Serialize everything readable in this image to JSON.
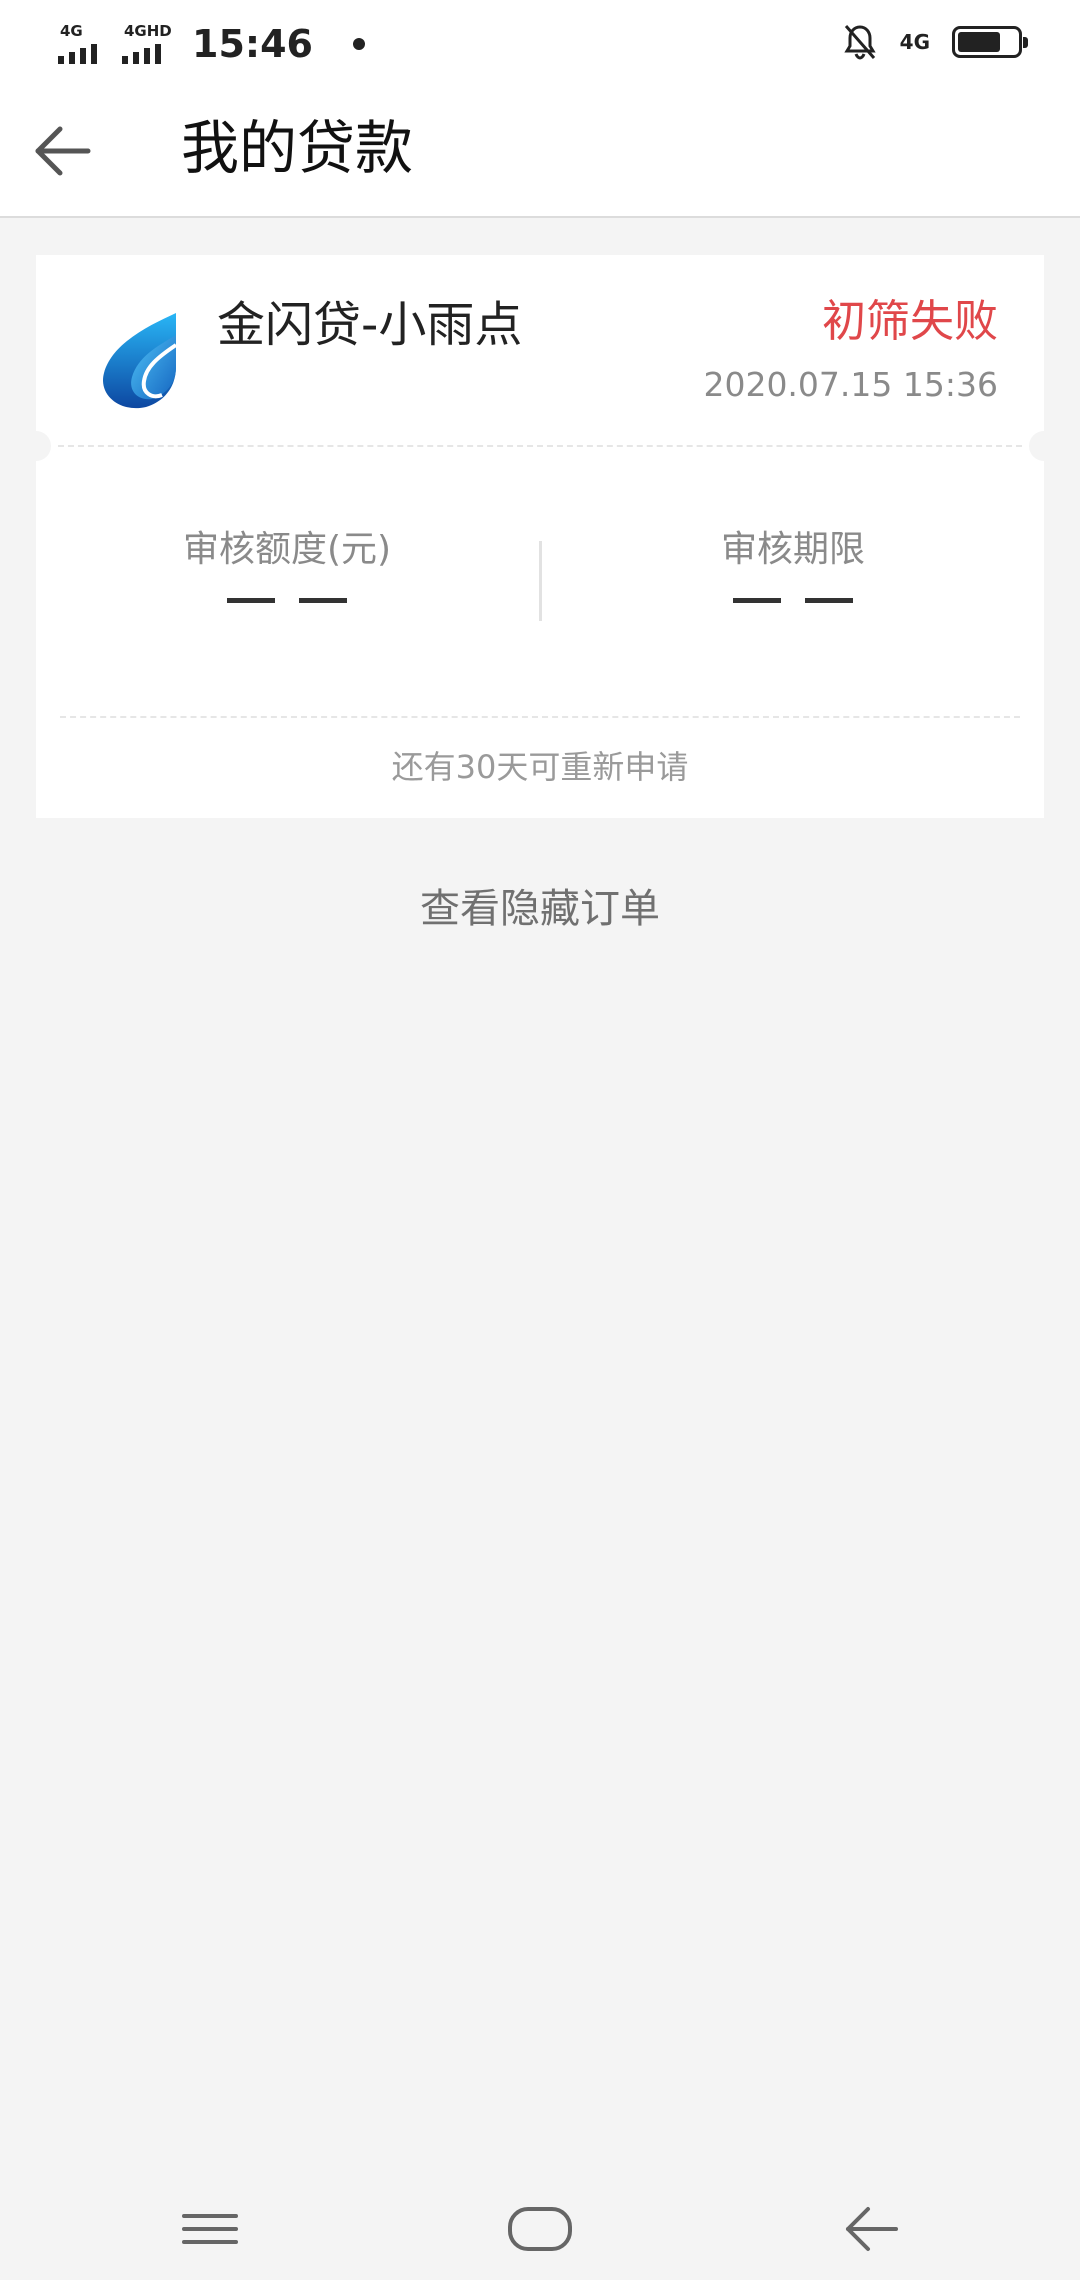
{
  "status_bar": {
    "sim1": "4G",
    "sim2": "4GHD",
    "time": "15:46",
    "data_type": "4G",
    "battery_level": 0.72,
    "icons": [
      "signal-icon",
      "notification-muted-icon",
      "battery-icon"
    ]
  },
  "header": {
    "title": "我的贷款",
    "back_icon": "back-arrow-icon"
  },
  "loan_card": {
    "product_name": "金闪贷-小雨点",
    "status": "初筛失败",
    "status_color": "#e0474a",
    "datetime": "2020.07.15 15:36",
    "logo_icon": "product-logo-icon",
    "amount": {
      "label": "审核额度(元)",
      "value": "— —"
    },
    "term": {
      "label": "审核期限",
      "value": "— —"
    },
    "reapply_note": "还有30天可重新申请"
  },
  "hidden_orders_link": "查看隐藏订单",
  "nav_bar": {
    "items": [
      "menu-icon",
      "home-icon",
      "back-icon"
    ]
  }
}
